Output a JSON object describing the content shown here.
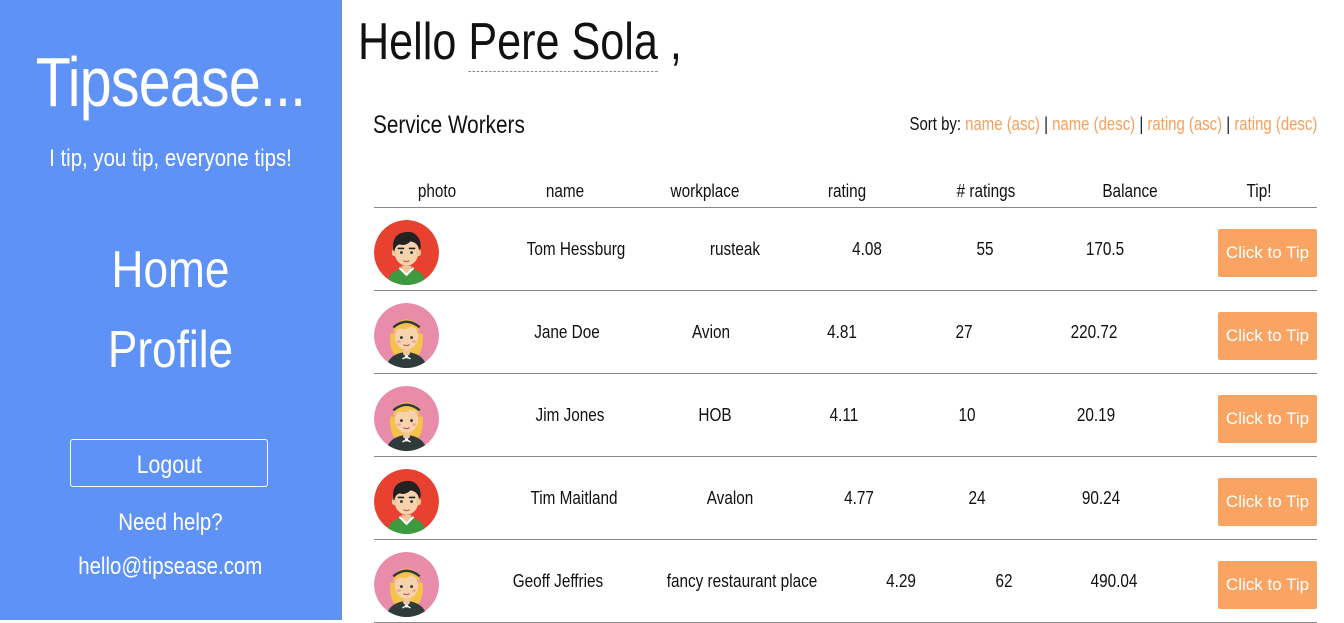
{
  "sidebar": {
    "brand": "Tipsease...",
    "tagline": "I tip, you tip, everyone tips!",
    "nav": [
      "Home",
      "Profile"
    ],
    "logout_label": "Logout",
    "help_text": "Need help?",
    "email": "hello@tipsease.com",
    "bg_color": "#5f92f6"
  },
  "greeting": {
    "prefix": "Hello",
    "user": "Pere Sola",
    "suffix": ","
  },
  "workers": {
    "title": "Service Workers",
    "sort": {
      "label": "Sort by:",
      "options": [
        "name (asc)",
        "name (desc)",
        "rating (asc)",
        "rating (desc)"
      ],
      "separator": "|"
    },
    "columns": [
      "photo",
      "name",
      "workplace",
      "rating",
      "# ratings",
      "Balance",
      "Tip!"
    ],
    "tip_label": "Click to Tip",
    "accent_color": "#f9a462",
    "rows": [
      {
        "avatar": "male-avatar-icon",
        "name": "Tom Hessburg",
        "workplace": "rusteak",
        "rating": "4.08",
        "num_ratings": "55",
        "balance": "170.5"
      },
      {
        "avatar": "female-avatar-icon",
        "name": "Jane Doe",
        "workplace": "Avion",
        "rating": "4.81",
        "num_ratings": "27",
        "balance": "220.72"
      },
      {
        "avatar": "female-avatar-icon",
        "name": "Jim Jones",
        "workplace": "HOB",
        "rating": "4.11",
        "num_ratings": "10",
        "balance": "20.19"
      },
      {
        "avatar": "male-avatar-icon",
        "name": "Tim Maitland",
        "workplace": "Avalon",
        "rating": "4.77",
        "num_ratings": "24",
        "balance": "90.24"
      },
      {
        "avatar": "female-avatar-icon",
        "name": "Geoff Jeffries",
        "workplace": "fancy restaurant place",
        "rating": "4.29",
        "num_ratings": "62",
        "balance": "490.04"
      }
    ]
  }
}
